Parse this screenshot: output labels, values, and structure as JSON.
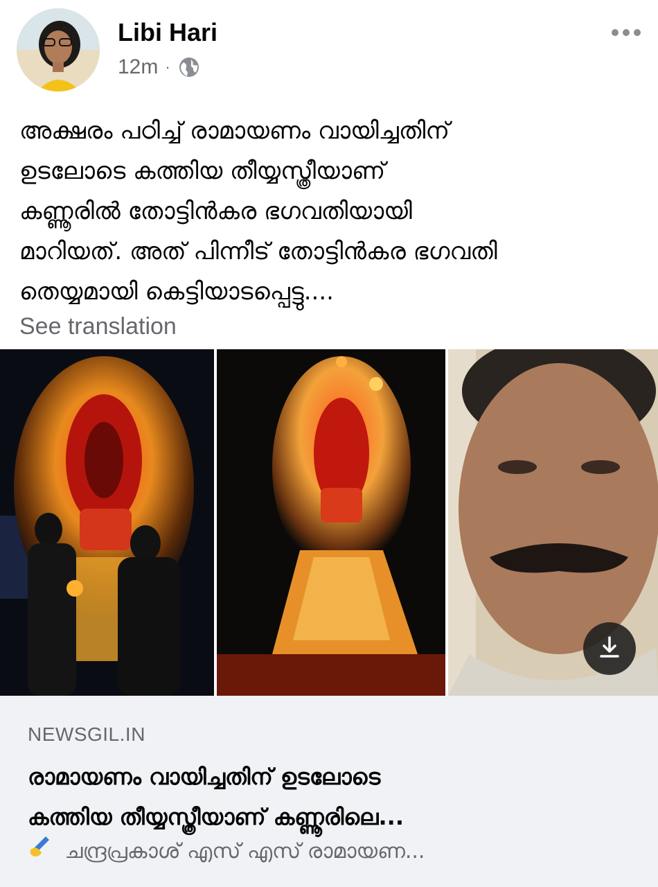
{
  "post": {
    "author_name": "Libi Hari",
    "timestamp": "12m",
    "separator": "·",
    "privacy_icon": "globe-icon",
    "more_icon": "more-horizontal-icon",
    "text_lines": [
      "അക്ഷരം പഠിച്ച് രാമായണം വായിച്ചതിന്",
      "ഉടലോടെ കത്തിയ തീയ്യസ്ത്രീയാണ്",
      "കണ്ണൂരിൽ തോട്ടിൻകര ഭഗവതിയായി",
      "മാറിയത്. അത് പിന്നീട് തോട്ടിൻകര ഭഗവതി",
      "തെയ്യമായി കെട്ടിയാടപ്പെട്ടു...."
    ],
    "see_translation": "See translation"
  },
  "photos": {
    "download_icon": "download-icon"
  },
  "link_card": {
    "domain": "NEWSGIL.IN",
    "title_lines": [
      "രാമായണം വായിച്ചതിന് ഉടലോടെ",
      "കത്തിയ തീയ്യസ്ത്രീയാണ് കണ്ണൂരിലെ..."
    ],
    "description_icon": "writing-hand-icon",
    "description": "ചന്ദ്രപ്രകാശ് എസ് എസ് രാമായണ..."
  },
  "colors": {
    "secondary_text": "#65676b",
    "card_background": "#f0f2f5",
    "primary_text": "#050505"
  }
}
